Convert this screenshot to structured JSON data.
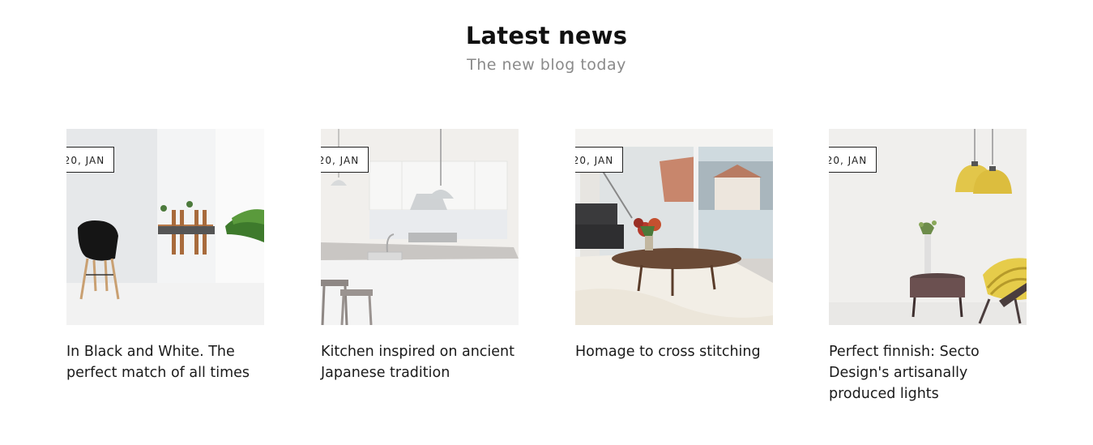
{
  "section": {
    "title": "Latest news",
    "subtitle": "The new blog today"
  },
  "posts": [
    {
      "date": "20, JAN",
      "title": "In Black and White. The perfect match of all times",
      "image": "black-chair-dining-room-photo"
    },
    {
      "date": "20, JAN",
      "title": "Kitchen inspired on ancient Japanese tradition",
      "image": "white-kitchen-photo"
    },
    {
      "date": "20, JAN",
      "title": "Homage to cross stitching",
      "image": "living-room-balcony-photo"
    },
    {
      "date": "20, JAN",
      "title": "Perfect finnish: Secto Design's artisanally produced lights",
      "image": "yellow-pendant-lights-photo"
    }
  ],
  "colors": {
    "text": "#111111",
    "subtitle": "#8a8a8a",
    "badge_border": "#222222",
    "background": "#ffffff"
  }
}
